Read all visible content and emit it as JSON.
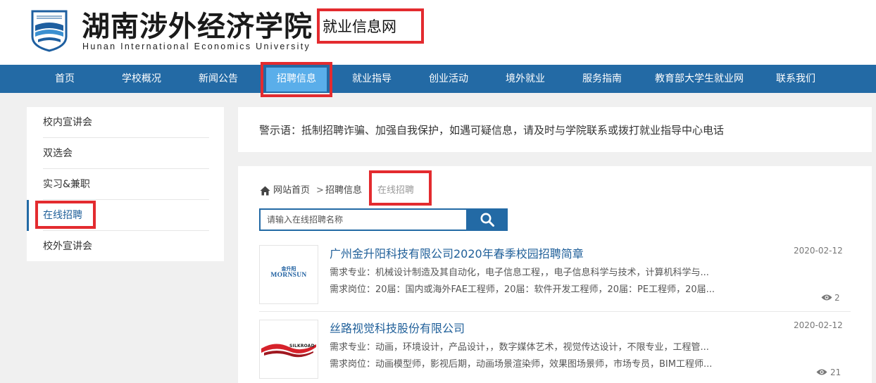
{
  "header": {
    "school_name": "湖南涉外经济学院",
    "school_name_en": "Hunan International Economics University",
    "site_name": "就业信息网"
  },
  "nav": {
    "items": [
      "首页",
      "学校概况",
      "新闻公告",
      "招聘信息",
      "就业指导",
      "创业活动",
      "境外就业",
      "服务指南",
      "教育部大学生就业网",
      "联系我们"
    ],
    "active_index": 3
  },
  "sidebar": {
    "items": [
      "校内宣讲会",
      "双选会",
      "实习&兼职",
      "在线招聘",
      "校外宣讲会"
    ],
    "active_index": 3
  },
  "notice": {
    "text": "警示语：抵制招聘诈骗、加强自我保护，如遇可疑信息，请及时与学院联系或拨打就业指导中心电话"
  },
  "breadcrumb": {
    "home": "网站首页",
    "separator": ">",
    "parent": "招聘信息",
    "current": "在线招聘"
  },
  "search": {
    "placeholder": "请输入在线招聘名称"
  },
  "jobs": [
    {
      "title": "广州金升阳科技有限公司2020年春季校园招聘简章",
      "date": "2020-02-12",
      "majors": "需求专业：机械设计制造及其自动化，电子信息工程，，电子信息科学与技术，计算机科学与...",
      "positions": "需求岗位：20届：国内或海外FAE工程师，20届：软件开发工程师，20届：PE工程师，20届...",
      "views": "2",
      "logo_text": "MORNSUN",
      "logo_sub": "金升阳"
    },
    {
      "title": "丝路视觉科技股份有限公司",
      "date": "2020-02-12",
      "majors": "需求专业：动画，环境设计，产品设计，，数字媒体艺术，视觉传达设计，不限专业，工程管...",
      "positions": "需求岗位：动画模型师，影视后期，动画场景渲染师，效果图场景师，市场专员，BIM工程师...",
      "views": "21",
      "logo_text": "SILKROAD"
    }
  ],
  "colors": {
    "nav_bg": "#236aa5",
    "nav_active": "#5aaeea",
    "highlight_border": "#e32b2f",
    "link": "#1f5f99"
  }
}
